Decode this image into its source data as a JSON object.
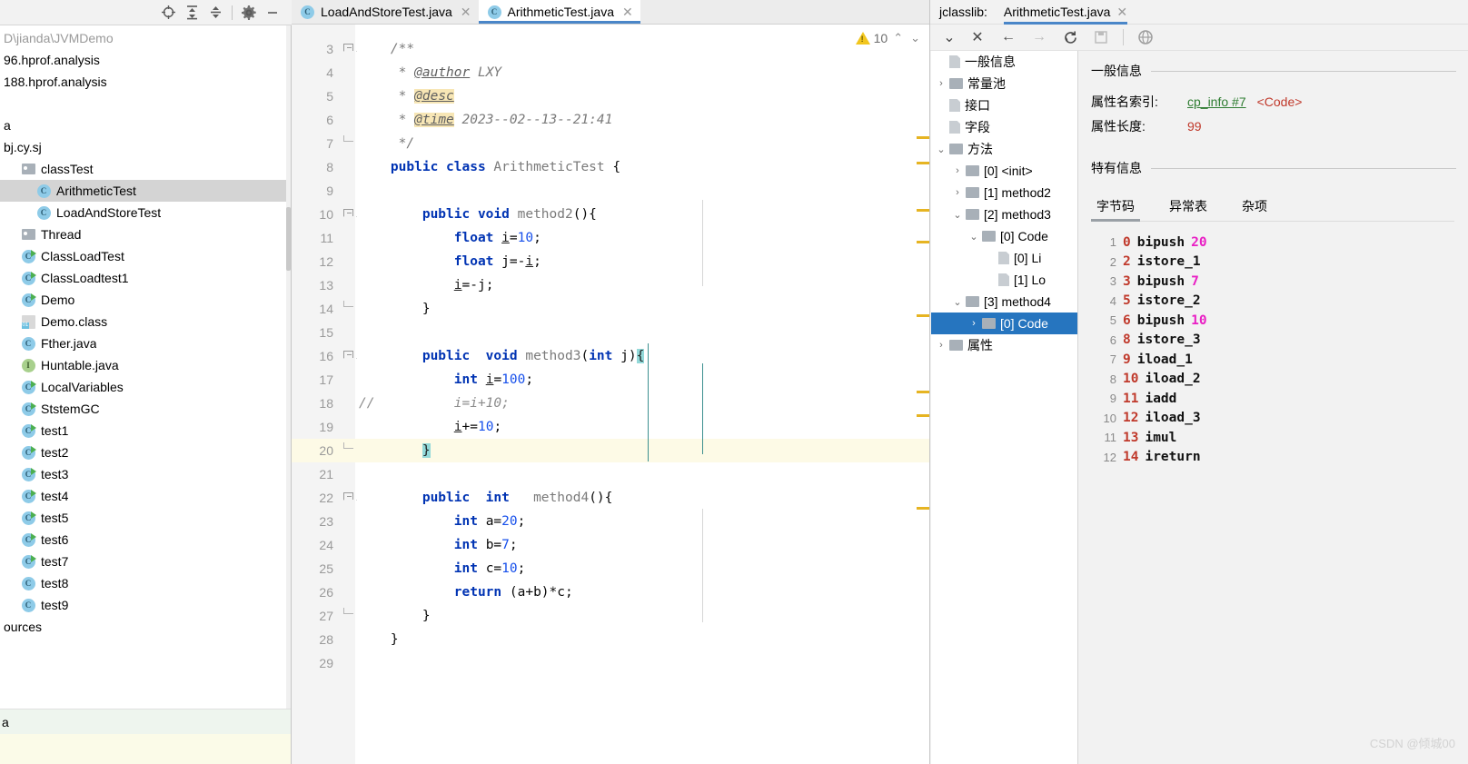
{
  "project_panel": {
    "toolbar": {
      "icons": [
        "locate-target-icon",
        "expand-all-icon",
        "collapse-all-icon",
        "settings-gear-icon",
        "hide-panel-icon"
      ]
    },
    "tree": [
      {
        "label": "D\\jianda\\JVMDemo",
        "icon": "none",
        "indent": 0,
        "muted": true,
        "arrow": ""
      },
      {
        "label": "96.hprof.analysis",
        "icon": "none",
        "indent": 0,
        "muted": false,
        "arrow": ""
      },
      {
        "label": "188.hprof.analysis",
        "icon": "none",
        "indent": 0,
        "muted": false,
        "arrow": ""
      },
      {
        "label": "",
        "icon": "none",
        "indent": 0,
        "muted": false,
        "arrow": ""
      },
      {
        "label": "a",
        "icon": "none",
        "indent": 0,
        "muted": false,
        "arrow": ""
      },
      {
        "label": "bj.cy.sj",
        "icon": "none",
        "indent": 0,
        "muted": false,
        "arrow": ""
      },
      {
        "label": "classTest",
        "icon": "folder",
        "indent": 1,
        "muted": false,
        "arrow": ""
      },
      {
        "label": "ArithmeticTest",
        "icon": "class",
        "indent": 2,
        "muted": false,
        "arrow": "",
        "selected": true
      },
      {
        "label": "LoadAndStoreTest",
        "icon": "class",
        "indent": 2,
        "muted": false,
        "arrow": ""
      },
      {
        "label": "Thread",
        "icon": "folder",
        "indent": 1,
        "muted": false,
        "arrow": ""
      },
      {
        "label": "ClassLoadTest",
        "icon": "class-run",
        "indent": 1,
        "muted": false,
        "arrow": ""
      },
      {
        "label": "ClassLoadtest1",
        "icon": "class-run",
        "indent": 1,
        "muted": false,
        "arrow": ""
      },
      {
        "label": "Demo",
        "icon": "class-run",
        "indent": 1,
        "muted": false,
        "arrow": ""
      },
      {
        "label": "Demo.class",
        "icon": "classfile",
        "indent": 1,
        "muted": false,
        "arrow": ""
      },
      {
        "label": "Fther.java",
        "icon": "class",
        "indent": 1,
        "muted": false,
        "arrow": ""
      },
      {
        "label": "Huntable.java",
        "icon": "interface",
        "indent": 1,
        "muted": false,
        "arrow": ""
      },
      {
        "label": "LocalVariables",
        "icon": "class-run",
        "indent": 1,
        "muted": false,
        "arrow": ""
      },
      {
        "label": "StstemGC",
        "icon": "class-run",
        "indent": 1,
        "muted": false,
        "arrow": ""
      },
      {
        "label": "test1",
        "icon": "class-run",
        "indent": 1,
        "muted": false,
        "arrow": ""
      },
      {
        "label": "test2",
        "icon": "class-run",
        "indent": 1,
        "muted": false,
        "arrow": ""
      },
      {
        "label": "test3",
        "icon": "class-run",
        "indent": 1,
        "muted": false,
        "arrow": ""
      },
      {
        "label": "test4",
        "icon": "class-run",
        "indent": 1,
        "muted": false,
        "arrow": ""
      },
      {
        "label": "test5",
        "icon": "class-run",
        "indent": 1,
        "muted": false,
        "arrow": ""
      },
      {
        "label": "test6",
        "icon": "class-run",
        "indent": 1,
        "muted": false,
        "arrow": ""
      },
      {
        "label": "test7",
        "icon": "class-run",
        "indent": 1,
        "muted": false,
        "arrow": ""
      },
      {
        "label": "test8",
        "icon": "class",
        "indent": 1,
        "muted": false,
        "arrow": ""
      },
      {
        "label": "test9",
        "icon": "class",
        "indent": 1,
        "muted": false,
        "arrow": ""
      },
      {
        "label": "ources",
        "icon": "none",
        "indent": 0,
        "muted": false,
        "arrow": ""
      }
    ],
    "footer_a_label": "a"
  },
  "editor": {
    "tabs": [
      {
        "label": "LoadAndStoreTest.java",
        "icon": "java-class-icon",
        "active": false
      },
      {
        "label": "ArithmeticTest.java",
        "icon": "java-class-icon",
        "active": true
      }
    ],
    "inspection": {
      "count": "10",
      "icon": "warning-triangle-icon"
    },
    "lines": [
      {
        "n": "3",
        "fold": "open",
        "html": "    <span class=\"jdoc\">/**</span>"
      },
      {
        "n": "4",
        "fold": "",
        "html": "     <span class=\"jdoc\">* </span><span class=\"jtag\">@author</span><span class=\"jdoc\"> LXY</span>"
      },
      {
        "n": "5",
        "fold": "",
        "html": "     <span class=\"jdoc\">* </span><span class=\"jtag-hl\">@desc</span>"
      },
      {
        "n": "6",
        "fold": "",
        "html": "     <span class=\"jdoc\">* </span><span class=\"jtag-hl\">@time</span><span class=\"jdoc\"> 2023--02--13--21:41</span>"
      },
      {
        "n": "7",
        "fold": "end",
        "html": "     <span class=\"jdoc\">*/</span>"
      },
      {
        "n": "8",
        "fold": "",
        "html": "    <span class=\"k\">public class</span> <span class=\"mth\">ArithmeticTest</span> <span class=\"plain\">{</span>"
      },
      {
        "n": "9",
        "fold": "",
        "html": ""
      },
      {
        "n": "10",
        "fold": "open",
        "html": "        <span class=\"k\">public void</span> <span class=\"mth\">method2</span><span class=\"plain\">(){</span>"
      },
      {
        "n": "11",
        "fold": "",
        "html": "            <span class=\"k\">float</span> <span class=\"var-u\">i</span><span class=\"plain\">=</span><span class=\"num\">10</span><span class=\"plain\">;</span>"
      },
      {
        "n": "12",
        "fold": "",
        "html": "            <span class=\"k\">float</span> <span class=\"plain\">j=-</span><span class=\"var-u\">i</span><span class=\"plain\">;</span>"
      },
      {
        "n": "13",
        "fold": "",
        "html": "            <span class=\"var-u\">i</span><span class=\"plain\">=-j;</span>"
      },
      {
        "n": "14",
        "fold": "end",
        "html": "        <span class=\"plain\">}</span>"
      },
      {
        "n": "15",
        "fold": "",
        "html": ""
      },
      {
        "n": "16",
        "fold": "open",
        "html": "        <span class=\"k\">public  void</span> <span class=\"mth\">method3</span><span class=\"plain\">(</span><span class=\"k\">int</span> <span class=\"plain\">j)</span><span class=\"brace-hl\">{</span>"
      },
      {
        "n": "17",
        "fold": "",
        "html": "            <span class=\"k\">int</span> <span class=\"var-u\">i</span><span class=\"plain\">=</span><span class=\"num\">100</span><span class=\"plain\">;</span>"
      },
      {
        "n": "18",
        "fold": "",
        "html": "<span class=\"cmt\">//          i=i+10;</span>"
      },
      {
        "n": "19",
        "fold": "",
        "html": "            <span class=\"var-u\">i</span><span class=\"plain\">+=</span><span class=\"num\">10</span><span class=\"plain\">;</span>"
      },
      {
        "n": "20",
        "fold": "end",
        "html": "        <span class=\"brace-hl\">}</span>",
        "highlight": true
      },
      {
        "n": "21",
        "fold": "",
        "html": ""
      },
      {
        "n": "22",
        "fold": "open",
        "html": "        <span class=\"k\">public  int</span>   <span class=\"mth\">method4</span><span class=\"plain\">(){</span>"
      },
      {
        "n": "23",
        "fold": "",
        "html": "            <span class=\"k\">int</span> <span class=\"plain\">a=</span><span class=\"num\">20</span><span class=\"plain\">;</span>"
      },
      {
        "n": "24",
        "fold": "",
        "html": "            <span class=\"k\">int</span> <span class=\"plain\">b=</span><span class=\"num\">7</span><span class=\"plain\">;</span>"
      },
      {
        "n": "25",
        "fold": "",
        "html": "            <span class=\"k\">int</span> <span class=\"plain\">c=</span><span class=\"num\">10</span><span class=\"plain\">;</span>"
      },
      {
        "n": "26",
        "fold": "",
        "html": "            <span class=\"k\">return</span> <span class=\"plain\">(a+b)*c;</span>"
      },
      {
        "n": "27",
        "fold": "end",
        "html": "        <span class=\"plain\">}</span>"
      },
      {
        "n": "28",
        "fold": "",
        "html": "    <span class=\"plain\">}</span>"
      },
      {
        "n": "29",
        "fold": "",
        "html": ""
      }
    ],
    "markers_y": [
      150,
      178,
      230,
      265,
      346,
      430,
      456,
      558
    ]
  },
  "jclasslib": {
    "tool_label": "jclasslib:",
    "tab": {
      "label": "ArithmeticTest.java",
      "close_icon": "close-icon"
    },
    "toolbar_icons": [
      "close-icon",
      "back-arrow-icon",
      "forward-arrow-icon",
      "refresh-icon",
      "save-icon",
      "browse-web-icon"
    ],
    "tree": [
      {
        "label": "一般信息",
        "arrow": "",
        "type": "leaf",
        "indent": 1
      },
      {
        "label": "常量池",
        "arrow": "›",
        "type": "folder",
        "indent": 1
      },
      {
        "label": "接口",
        "arrow": "",
        "type": "leaf",
        "indent": 1
      },
      {
        "label": "字段",
        "arrow": "",
        "type": "leaf",
        "indent": 1
      },
      {
        "label": "方法",
        "arrow": "⌄",
        "type": "folder",
        "indent": 1
      },
      {
        "label": "[0] <init>",
        "arrow": "›",
        "type": "folder",
        "indent": 2
      },
      {
        "label": "[1] method2",
        "arrow": "›",
        "type": "folder",
        "indent": 2
      },
      {
        "label": "[2] method3",
        "arrow": "⌄",
        "type": "folder",
        "indent": 2
      },
      {
        "label": "[0] Code",
        "arrow": "⌄",
        "type": "folder",
        "indent": 3
      },
      {
        "label": "[0] Li",
        "arrow": "",
        "type": "leaf",
        "indent": 4
      },
      {
        "label": "[1] Lo",
        "arrow": "",
        "type": "leaf",
        "indent": 4
      },
      {
        "label": "[3] method4",
        "arrow": "⌄",
        "type": "folder",
        "indent": 2
      },
      {
        "label": "[0] Code",
        "arrow": "›",
        "type": "folder",
        "indent": 3,
        "selected": true
      },
      {
        "label": "属性",
        "arrow": "›",
        "type": "folder",
        "indent": 1
      }
    ],
    "detail": {
      "general_section": "一般信息",
      "attr_name_label": "属性名索引:",
      "attr_name_link": "cp_info #7",
      "attr_name_code": "<Code>",
      "attr_len_label": "属性长度:",
      "attr_len_value": "99",
      "specific_section": "特有信息",
      "bc_tabs": [
        {
          "label": "字节码",
          "active": true
        },
        {
          "label": "异常表",
          "active": false
        },
        {
          "label": "杂项",
          "active": false
        }
      ]
    },
    "bytecode": [
      {
        "idx": "1",
        "offset": "0",
        "op": "bipush",
        "arg": "20"
      },
      {
        "idx": "2",
        "offset": "2",
        "op": "istore_1",
        "arg": ""
      },
      {
        "idx": "3",
        "offset": "3",
        "op": "bipush",
        "arg": "7"
      },
      {
        "idx": "4",
        "offset": "5",
        "op": "istore_2",
        "arg": ""
      },
      {
        "idx": "5",
        "offset": "6",
        "op": "bipush",
        "arg": "10"
      },
      {
        "idx": "6",
        "offset": "8",
        "op": "istore_3",
        "arg": ""
      },
      {
        "idx": "7",
        "offset": "9",
        "op": "iload_1",
        "arg": ""
      },
      {
        "idx": "8",
        "offset": "10",
        "op": "iload_2",
        "arg": ""
      },
      {
        "idx": "9",
        "offset": "11",
        "op": "iadd",
        "arg": ""
      },
      {
        "idx": "10",
        "offset": "12",
        "op": "iload_3",
        "arg": ""
      },
      {
        "idx": "11",
        "offset": "13",
        "op": "imul",
        "arg": ""
      },
      {
        "idx": "12",
        "offset": "14",
        "op": "ireturn",
        "arg": ""
      }
    ]
  },
  "watermark": "CSDN @倾城00",
  "colors": {
    "accent_blue": "#4a86c8",
    "selection_blue": "#2675bf",
    "warning_yellow": "#f2c61e",
    "marker_yellow": "#e6b422",
    "keyword_blue": "#0033b3",
    "number_blue": "#1750eb",
    "link_green": "#2f7d32",
    "value_red": "#c0392b",
    "bytecode_arg_magenta": "#e91ec4"
  }
}
